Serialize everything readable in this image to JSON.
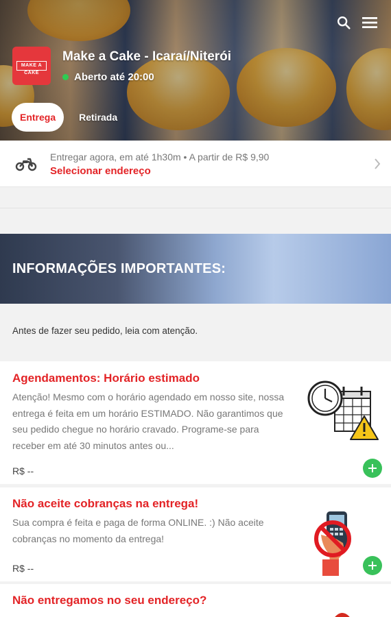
{
  "header": {
    "store_name": "Make a Cake - Icaraí/Niterói",
    "logo_text": "MAKE A CAKE",
    "status": "Aberto até 20:00",
    "icons": [
      "search-icon",
      "menu-icon"
    ],
    "tabs": [
      {
        "label": "Entrega",
        "active": true
      },
      {
        "label": "Retirada",
        "active": false
      }
    ]
  },
  "delivery": {
    "info": "Entregar agora, em até 1h30m • A partir de R$ 9,90",
    "action": "Selecionar endereço",
    "icon": "motorcycle-icon"
  },
  "banner": {
    "title": "INFORMAÇÕES IMPORTANTES:"
  },
  "notice": "Antes de fazer seu pedido, leia com atenção.",
  "items": [
    {
      "title": "Agendamentos: Horário estimado",
      "desc": "Atenção! Mesmo com o horário agendado em nosso site, nossa entrega é feita em um horário ESTIMADO. Não garantimos que seu pedido chegue no horário cravado. Programe-se para receber em até 30 minutos antes ou...",
      "price": "R$ --",
      "image": "clock-calendar-warning-icon"
    },
    {
      "title": "Não aceite cobranças na entrega!",
      "desc": "Sua compra é feita e paga de forma ONLINE. :) Não aceite cobranças no momento da entrega!",
      "price": "R$ --",
      "image": "no-card-machine-icon"
    },
    {
      "title": "Não entregamos no seu endereço?",
      "image": "red-badge-icon"
    }
  ],
  "colors": {
    "accent": "#e32326",
    "add_button": "#39c15a",
    "status_dot": "#2ecc52",
    "logo_bg": "#e5373c"
  }
}
